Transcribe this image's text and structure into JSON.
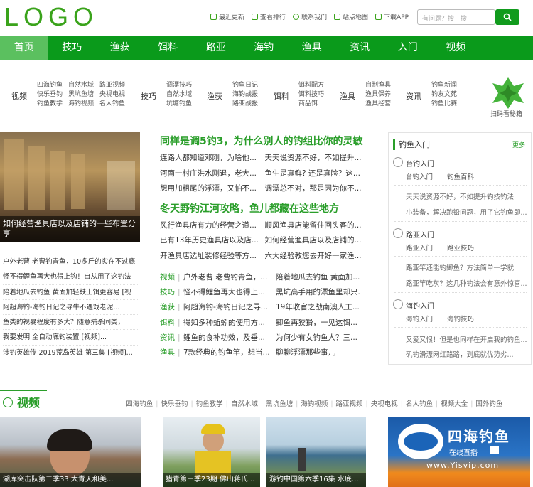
{
  "header": {
    "logo": "LOGO",
    "links": [
      "最近更新",
      "查看排行",
      "联系我们",
      "站点地图",
      "下载APP"
    ],
    "search_placeholder": "有问题？搜一搜"
  },
  "nav": [
    "首页",
    "技巧",
    "渔获",
    "饵料",
    "路亚",
    "海钓",
    "渔具",
    "资讯",
    "入门",
    "视频"
  ],
  "categories": [
    {
      "label": "视频",
      "links": [
        "四海钓鱼",
        "自然水域",
        "路亚视频",
        "快乐垂钓",
        "黑坑鱼塘",
        "央视电视",
        "钓鱼教学",
        "海钓视频",
        "名人钓鱼"
      ]
    },
    {
      "label": "技巧",
      "links": [
        "调漂技巧",
        "自然水域",
        "坑塘钓鱼"
      ]
    },
    {
      "label": "渔获",
      "links": [
        "钓鱼日记",
        "海钓战报",
        "路亚战报"
      ]
    },
    {
      "label": "饵料",
      "links": [
        "饵料配方",
        "饵料技巧",
        "商品饵"
      ]
    },
    {
      "label": "渔具",
      "links": [
        "自制渔具",
        "渔具保养",
        "渔具经营"
      ]
    },
    {
      "label": "资讯",
      "links": [
        "钓鱼新闻",
        "钓友文苑",
        "钓鱼比赛"
      ]
    }
  ],
  "qr_label": "扫码看秘籍",
  "feature": {
    "caption": "如何经营渔具店以及店铺的一些布置分享"
  },
  "left_list": [
    "户外老曹 老曹钓青鱼，10多斤的实在不过瘾",
    "怪不得鲤鱼再大也得上钩！自从用了这钓法",
    "陪着地瓜去钓鱼 黄面加轻麸上饵更容易 [视",
    "阿超海钓-海钓日记之寻牛不遇戏老泥...",
    "鱼类的视暴程度有多大？随意捕杀同类，",
    "我要发明 全自动底钓装置 [视频]...",
    "涉钓英雄传 2019荒岛英雄 第三集 [视频]..."
  ],
  "mid": {
    "headline1": "同样是调5钓3，为什么别人的钓组比你的灵敏",
    "pairs1": [
      [
        "连路人都知道邓刚，为啥他...",
        "天天说资源不好，不如提升..."
      ],
      [
        "河南一村庄洪水刚退，老大...",
        "鱼生是真鲜? 还是真险？这..."
      ],
      [
        "想用加粗尾的浮漂，又怕不...",
        "调漂总不对，那是因为你不..."
      ]
    ],
    "headline2": "冬天野钓江河攻略，鱼儿都藏在这些地方",
    "pairs2": [
      [
        "风行渔具店有力的经营之道...",
        "顺风渔具店能留住回头客的..."
      ],
      [
        "已有13年历史渔具店以及店...",
        "如何经营渔具店以及店铺的..."
      ],
      [
        "开渔具店选址装修经验等方...",
        "六大经验教您去开好一家渔..."
      ]
    ],
    "tagged": [
      {
        "tag": "视频",
        "a": "户外老曹 老曹钓青鱼，...",
        "b": "陪着地瓜去钓鱼 黄面加..."
      },
      {
        "tag": "技巧",
        "a": "怪不得鲤鱼再大也得上...",
        "b": "黑坑高手用的漂鱼里却只..."
      },
      {
        "tag": "渔获",
        "a": "阿超海钓-海钓日记之寻...",
        "b": "19年收官之战南澳人工..."
      },
      {
        "tag": "饵料",
        "a": "得知多种蚯蚓的使用方...",
        "b": "鲫鱼再狡猾，一见这饵..."
      },
      {
        "tag": "资讯",
        "a": "鲤鱼的食补功效，及垂...",
        "b": "为何少有女钓鱼人？三..."
      },
      {
        "tag": "渔具",
        "a": "7款经典的钓鱼竿，想当...",
        "b": "聊聊浮漂那些事儿"
      }
    ]
  },
  "side": {
    "title": "钓鱼入门",
    "more": "更多",
    "blocks": [
      {
        "title": "台钓入门",
        "links": [
          "台钓入门",
          "钓鱼百科"
        ],
        "texts": [
          "天天说资源不好，不如提升钓技钓法...",
          "小装备，解决跑铅问题，用了它钓鱼即..."
        ]
      },
      {
        "title": "路亚入门",
        "links": [
          "路亚入门",
          "路亚技巧"
        ],
        "texts": [
          "路亚竿还能钓鲫鱼？方法简单一学就...",
          "路亚竿吃灰？这几种钓法会有意外惊喜..."
        ]
      },
      {
        "title": "海钓入门",
        "links": [
          "海钓入门",
          "海钓技巧"
        ],
        "texts": [
          "又爱又恨！但是也同样在开启我的钓鱼...",
          "矶钓滑漂网红路路，到底就优势劣..."
        ]
      }
    ]
  },
  "video": {
    "title": "视频",
    "tabs": [
      "四海钓鱼",
      "快乐垂钓",
      "钓鱼教学",
      "自然水域",
      "黑坑鱼塘",
      "海钓视频",
      "路亚视频",
      "央视电视",
      "名人钓鱼",
      "视频大全",
      "国外钓鱼"
    ],
    "thumbs": [
      "湖库突击队第二季33 大青天和美...",
      "猎青第三季23期 佛山蒋氏...",
      "游钓中国第六季16集 水底..."
    ],
    "ad_title": "四海钓鱼",
    "ad_sub": "在线直播",
    "ad_water": "www.Yisvip.com"
  },
  "colors": {
    "brand": "#0a9a1b",
    "nav_active": "#5bc05f",
    "headline": "#2a9e2a"
  }
}
